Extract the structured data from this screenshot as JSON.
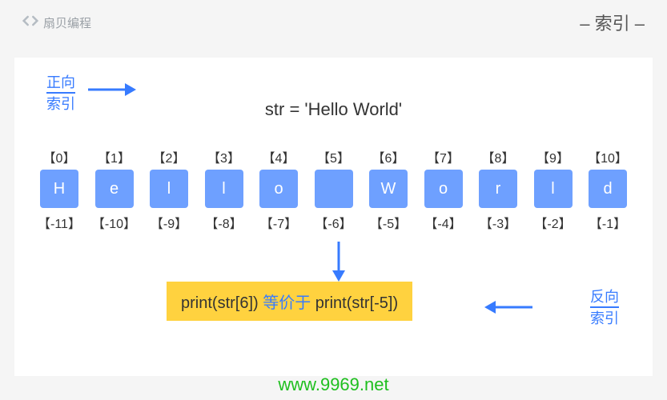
{
  "header": {
    "brand": "扇贝编程",
    "title": "– 索引 –"
  },
  "forward": {
    "line1": "正向",
    "line2": "索引"
  },
  "backward": {
    "line1": "反向",
    "line2": "索引"
  },
  "code": "str = 'Hello World'",
  "cells": [
    {
      "pos": "【0】",
      "neg": "【-11】",
      "ch": "H"
    },
    {
      "pos": "【1】",
      "neg": "【-10】",
      "ch": "e"
    },
    {
      "pos": "【2】",
      "neg": "【-9】",
      "ch": "l"
    },
    {
      "pos": "【3】",
      "neg": "【-8】",
      "ch": "l"
    },
    {
      "pos": "【4】",
      "neg": "【-7】",
      "ch": "o"
    },
    {
      "pos": "【5】",
      "neg": "【-6】",
      "ch": " "
    },
    {
      "pos": "【6】",
      "neg": "【-5】",
      "ch": "W"
    },
    {
      "pos": "【7】",
      "neg": "【-4】",
      "ch": "o"
    },
    {
      "pos": "【8】",
      "neg": "【-3】",
      "ch": "r"
    },
    {
      "pos": "【9】",
      "neg": "【-2】",
      "ch": "l"
    },
    {
      "pos": "【10】",
      "neg": "【-1】",
      "ch": "d"
    }
  ],
  "highlight": {
    "p1": "print(str[6]) ",
    "eq": "等价于",
    "p2": " print(str[-5])"
  },
  "watermark": "www.9969.net",
  "colors": {
    "accent": "#377bff",
    "box": "#6ea0ff",
    "highlight_bg": "#ffd23f",
    "watermark": "#1fbf1f"
  }
}
